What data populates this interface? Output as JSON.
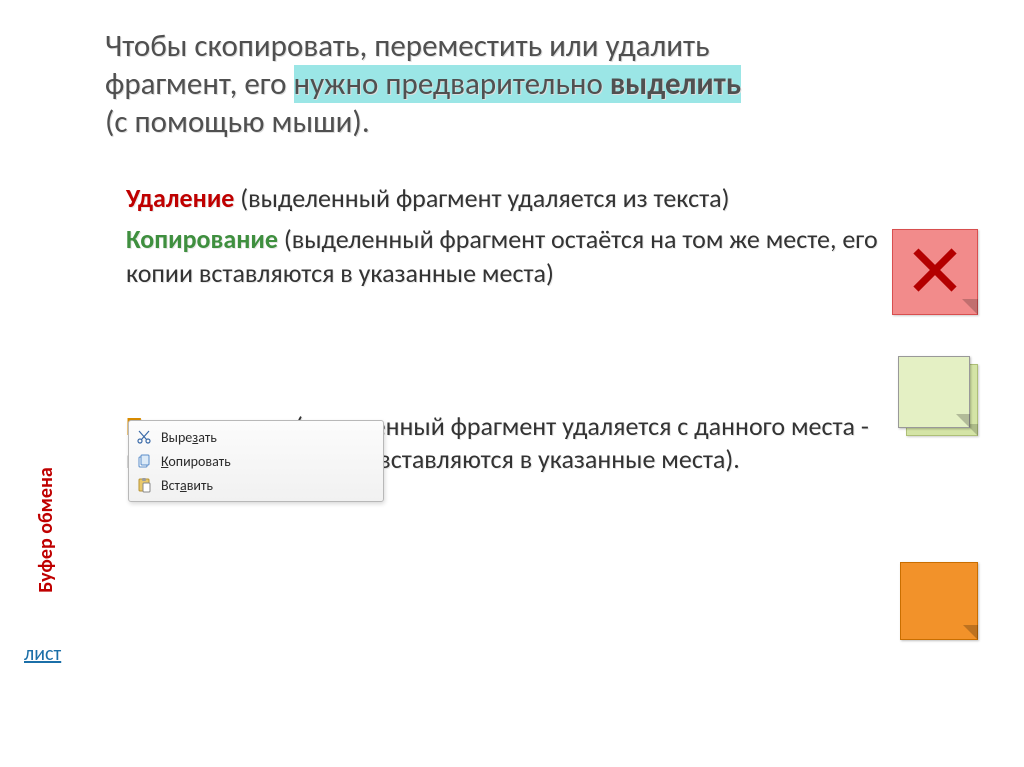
{
  "title": {
    "line1": "Чтобы скопировать, переместить или удалить",
    "line2_prefix": "фрагмент, его ",
    "line2_hl": "нужно предварительно ",
    "line2_hl_bold": "выделить",
    "line3": "(с помощью мыши)."
  },
  "sidebar": {
    "clipboard_label": "Буфер обмена",
    "link": "лист"
  },
  "body": {
    "delete_kw": "Удаление",
    "delete_text": " (выделенный фрагмент удаляется из текста)",
    "copy_kw": "Копирование",
    "copy_text": " (выделенный фрагмент остаётся на том же месте,  его копии вставляются в указанные места)",
    "move_kw": "Перемещение",
    "move_text": " (выделенный фрагмент удаляется с данного места -  вырезается, его копии вставляются в указанные места)."
  },
  "context_menu": {
    "cut_prefix": "Выре",
    "cut_u": "з",
    "cut_suffix": "ать",
    "copy_u": "К",
    "copy_suffix": "опировать",
    "paste_prefix": "Вст",
    "paste_u": "а",
    "paste_suffix": "вить"
  },
  "icons": {
    "x": "✕"
  }
}
